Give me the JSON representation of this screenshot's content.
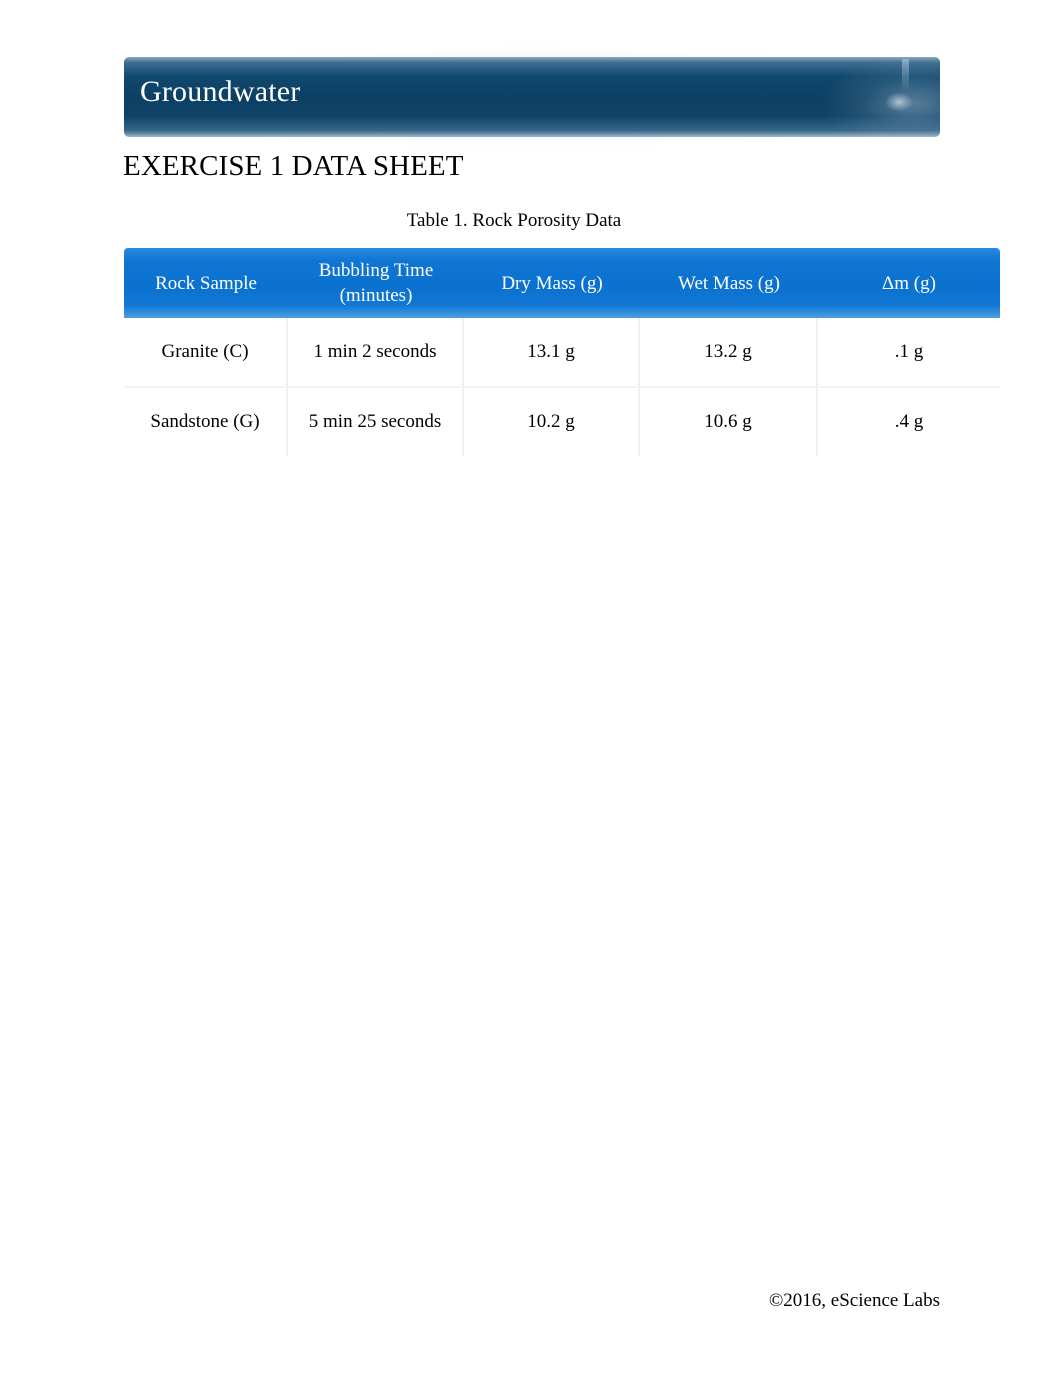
{
  "document": {
    "banner_title": "Groundwater",
    "heading": "EXERCISE 1 DATA SHEET",
    "footer": "©2016, eScience Labs"
  },
  "colors": {
    "banner_dark": "#0c3f63",
    "table_header_blue": "#0b71cf",
    "page_background": "#ffffff",
    "text": "#000000"
  },
  "table": {
    "caption": "Table 1. Rock Porosity Data",
    "columns": [
      "Rock Sample",
      "Bubbling Time (minutes)",
      "Dry Mass (g)",
      "Wet Mass (g)",
      "Δm (g)"
    ],
    "column_lines": [
      [
        "Rock Sample"
      ],
      [
        "Bubbling Time",
        "(minutes)"
      ],
      [
        "Dry Mass (g)"
      ],
      [
        "Wet Mass (g)"
      ],
      [
        "Δm (g)"
      ]
    ],
    "rows": [
      {
        "rock_sample": "Granite (C)",
        "bubbling_time": "1 min 2 seconds",
        "dry_mass": "13.1 g",
        "wet_mass": "13.2 g",
        "delta_m": ".1 g"
      },
      {
        "rock_sample": "Sandstone (G)",
        "bubbling_time": "5 min 25 seconds",
        "dry_mass": "10.2 g",
        "wet_mass": "10.6 g",
        "delta_m": ".4 g"
      }
    ]
  }
}
